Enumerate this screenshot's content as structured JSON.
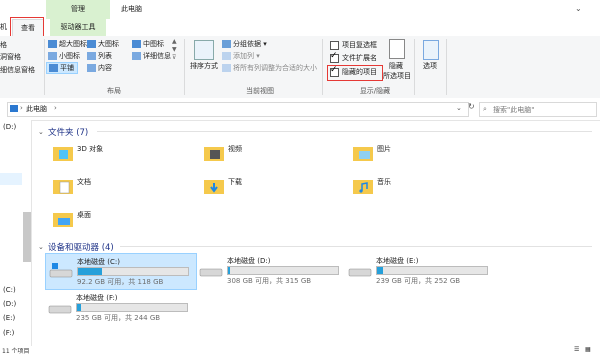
{
  "title": {
    "manage": "管理",
    "window_title": "此电脑"
  },
  "tabs": {
    "left_cut": "机",
    "view": "查看",
    "drive_tools": "驱动器工具"
  },
  "ribbon": {
    "layout_items": [
      {
        "label": "超大图标"
      },
      {
        "label": "大图标"
      },
      {
        "label": "中图标"
      },
      {
        "label": "小图标"
      },
      {
        "label": "列表"
      },
      {
        "label": "详细信息"
      },
      {
        "label": "平铺"
      },
      {
        "label": "内容"
      }
    ],
    "layout_label": "布局",
    "sort_label": "排序方式",
    "group_by": "分组依据",
    "add_column": "添加列",
    "fit_columns": "将所有列调整为合适的大小",
    "current_view_label": "当前视图",
    "item_checkbox": "项目复选框",
    "file_ext": "文件扩展名",
    "hidden_items": "隐藏的项目",
    "hide": "隐藏",
    "hide_selected": "所选项目",
    "show_hide_label": "显示/隐藏",
    "options": "选项",
    "left_cut_1": "格",
    "left_cut_2": "洞窗格",
    "left_cut_3": "细信息窗格",
    "checks": {
      "item_checkbox": false,
      "file_ext": true,
      "hidden_items": true
    }
  },
  "address": {
    "path": "此电脑",
    "search_placeholder": "搜索\"此电脑\""
  },
  "nav": {
    "items": [
      "(D:)",
      "(C:)",
      "(D:)",
      "(E:)",
      "(F:)"
    ]
  },
  "folders": {
    "header": "文件夹 (7)",
    "items": [
      {
        "name": "3D 对象"
      },
      {
        "name": "视频"
      },
      {
        "name": "图片"
      },
      {
        "name": "文档"
      },
      {
        "name": "下载"
      },
      {
        "name": "音乐"
      },
      {
        "name": "桌面"
      }
    ]
  },
  "drives": {
    "header": "设备和驱动器 (4)",
    "items": [
      {
        "name": "本地磁盘 (C:)",
        "free": "92.2 GB 可用，共 118 GB",
        "used_fraction": 0.22
      },
      {
        "name": "本地磁盘 (D:)",
        "free": "308 GB 可用，共 315 GB",
        "used_fraction": 0.02
      },
      {
        "name": "本地磁盘 (E:)",
        "free": "239 GB 可用，共 252 GB",
        "used_fraction": 0.05
      },
      {
        "name": "本地磁盘 (F:)",
        "free": "235 GB 可用，共 244 GB",
        "used_fraction": 0.04
      }
    ]
  },
  "status": {
    "count": "11 个项目"
  }
}
